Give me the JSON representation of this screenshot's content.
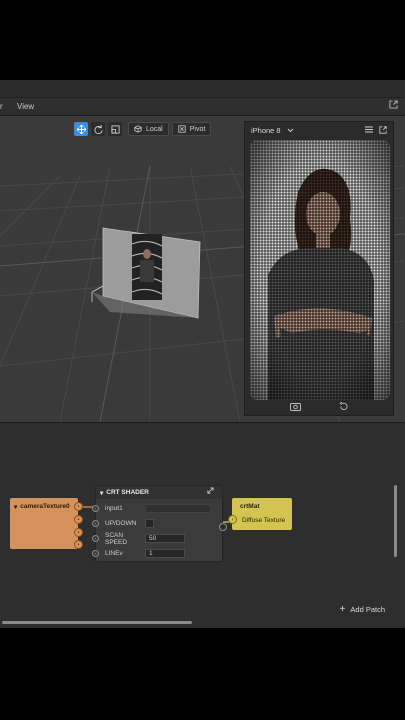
{
  "menubar": {
    "item_left": "r",
    "item_view": "View"
  },
  "toolbar": {
    "local_label": "Local",
    "pivot_label": "Pivot"
  },
  "simulator": {
    "device": "iPhone 8"
  },
  "patch_editor": {
    "camera_node": {
      "title": "cameraTexture0"
    },
    "crt_node": {
      "title": "CRT SHADER",
      "rows": [
        {
          "label": "input1",
          "value": ""
        },
        {
          "label": "UP/DOWN",
          "value": ""
        },
        {
          "label": "SCAN SPEED",
          "value": "50"
        },
        {
          "label": "LINEv",
          "value": "1"
        }
      ]
    },
    "material_node": {
      "title": "crtMat",
      "input_label": "Diffuse Texture"
    },
    "add_patch_label": "Add Patch"
  },
  "colors": {
    "accent": "#3b8fe0",
    "camera_node": "#d5925a",
    "material_node": "#d4c450",
    "patch_bg": "#2e2e2e",
    "viewport_bg": "#3a3a3a"
  }
}
